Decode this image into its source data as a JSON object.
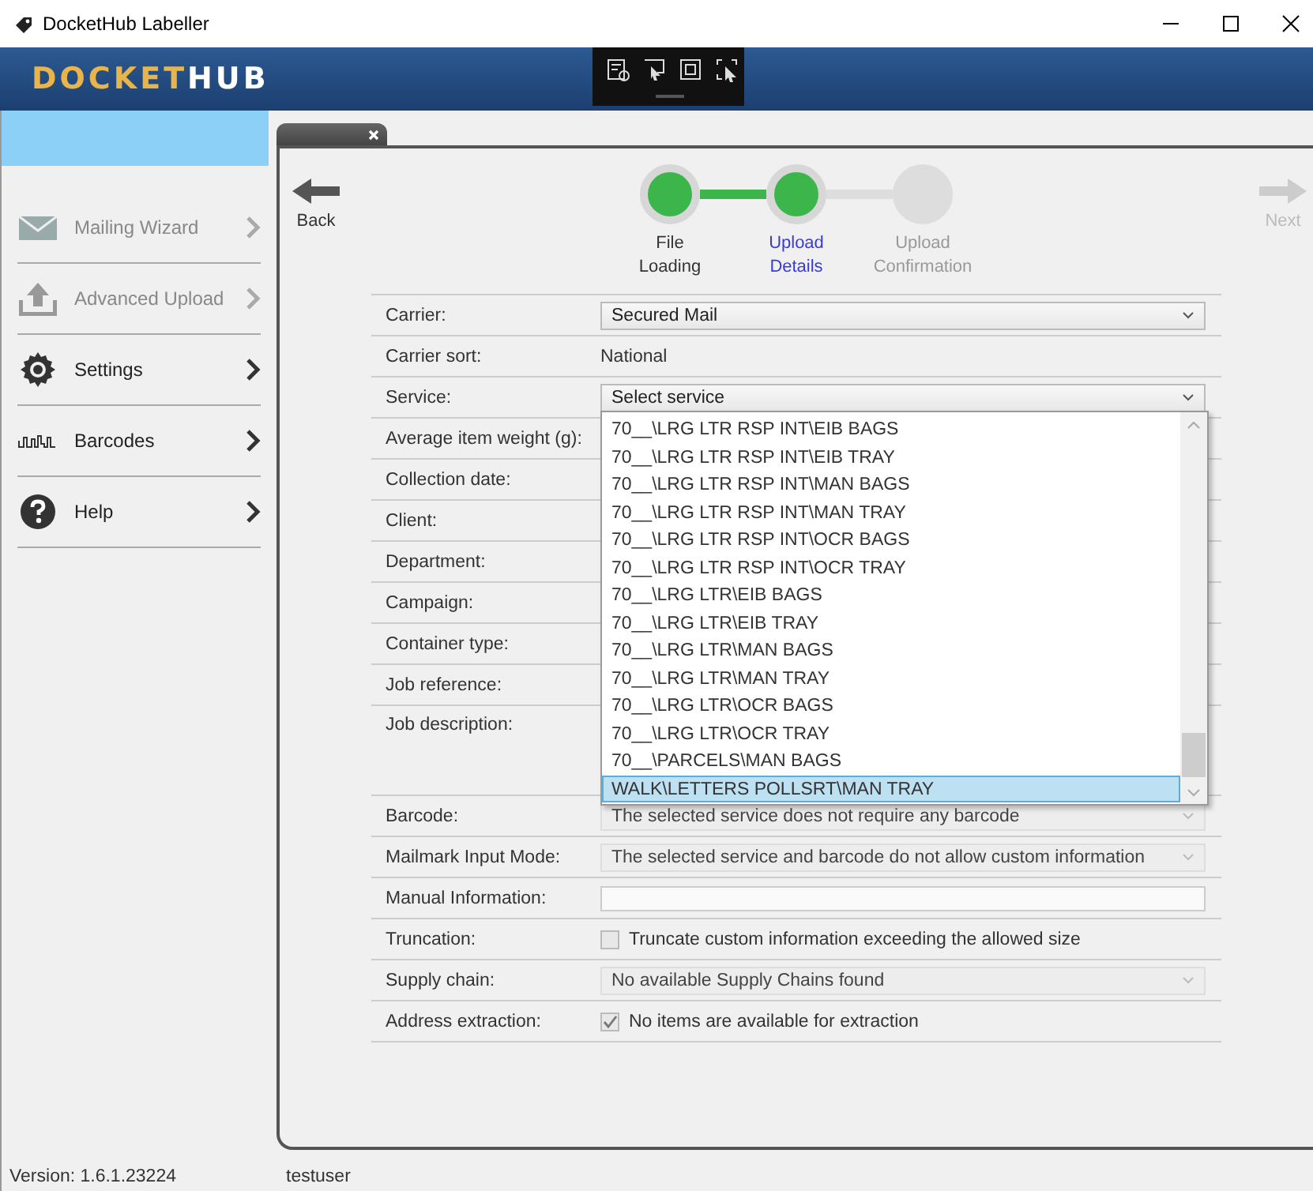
{
  "window": {
    "title": "DocketHub Labeller"
  },
  "logo": {
    "primary": "DOCKET",
    "secondary": "HUB"
  },
  "sidebar": {
    "items": [
      {
        "label": "Mailing Wizard",
        "disabled": true
      },
      {
        "label": "Advanced Upload",
        "disabled": true
      },
      {
        "label": "Settings",
        "disabled": false
      },
      {
        "label": "Barcodes",
        "disabled": false
      },
      {
        "label": "Help",
        "disabled": false
      }
    ]
  },
  "navigation": {
    "back": {
      "label": "Back",
      "disabled": false
    },
    "next": {
      "label": "Next",
      "disabled": true
    }
  },
  "steps": [
    {
      "label": "File\nLoading",
      "completed": true,
      "selected": false
    },
    {
      "label": "Upload\nDetails",
      "completed": true,
      "selected": true
    },
    {
      "label": "Upload\nConfirmation",
      "completed": false,
      "selected": false
    }
  ],
  "form": {
    "rows": [
      {
        "label": "Carrier:",
        "kind": "select",
        "value": "Secured Mail",
        "disabled": false
      },
      {
        "label": "Carrier sort:",
        "kind": "text",
        "value": "National"
      },
      {
        "label": "Service:",
        "kind": "select",
        "value": "Select service",
        "disabled": false
      },
      {
        "label": "Average item weight (g):"
      },
      {
        "label": "Collection date:"
      },
      {
        "label": "Client:"
      },
      {
        "label": "Department:"
      },
      {
        "label": "Campaign:"
      },
      {
        "label": "Container type:"
      },
      {
        "label": "Job reference:"
      },
      {
        "label": "Job description:",
        "kind": "tall"
      },
      {
        "label": "Barcode:",
        "kind": "select",
        "value": "The selected service does not require any barcode",
        "disabled": true
      },
      {
        "label": "Mailmark Input Mode:",
        "kind": "select",
        "value": "The selected service and barcode do not allow custom information",
        "disabled": true
      },
      {
        "label": "Manual Information:",
        "kind": "input"
      },
      {
        "label": "Truncation:",
        "kind": "checkbox",
        "value": "Truncate custom information exceeding the allowed size",
        "checked": false,
        "disabled": true
      },
      {
        "label": "Supply chain:",
        "kind": "select",
        "value": "No available Supply Chains found",
        "disabled": true
      },
      {
        "label": "Address extraction:",
        "kind": "checkbox",
        "value": "No items are available for extraction",
        "checked": true,
        "disabled": true
      }
    ]
  },
  "service_list": {
    "items": [
      {
        "label": "70__\\LRG LTR RSP INT\\EIB BAGS",
        "selected": false
      },
      {
        "label": "70__\\LRG LTR RSP INT\\EIB TRAY",
        "selected": false
      },
      {
        "label": "70__\\LRG LTR RSP INT\\MAN BAGS",
        "selected": false
      },
      {
        "label": "70__\\LRG LTR RSP INT\\MAN TRAY",
        "selected": false
      },
      {
        "label": "70__\\LRG LTR RSP INT\\OCR BAGS",
        "selected": false
      },
      {
        "label": "70__\\LRG LTR RSP INT\\OCR TRAY",
        "selected": false
      },
      {
        "label": "70__\\LRG LTR\\EIB BAGS",
        "selected": false
      },
      {
        "label": "70__\\LRG LTR\\EIB TRAY",
        "selected": false
      },
      {
        "label": "70__\\LRG LTR\\MAN BAGS",
        "selected": false
      },
      {
        "label": "70__\\LRG LTR\\MAN TRAY",
        "selected": false
      },
      {
        "label": "70__\\LRG LTR\\OCR BAGS",
        "selected": false
      },
      {
        "label": "70__\\LRG LTR\\OCR TRAY",
        "selected": false
      },
      {
        "label": "70__\\PARCELS\\MAN BAGS",
        "selected": false
      },
      {
        "label": "WALK\\LETTERS POLLSRT\\MAN TRAY",
        "selected": true
      }
    ]
  },
  "status_bar": {
    "version": "Version: 1.6.1.23224",
    "user": "testuser"
  }
}
